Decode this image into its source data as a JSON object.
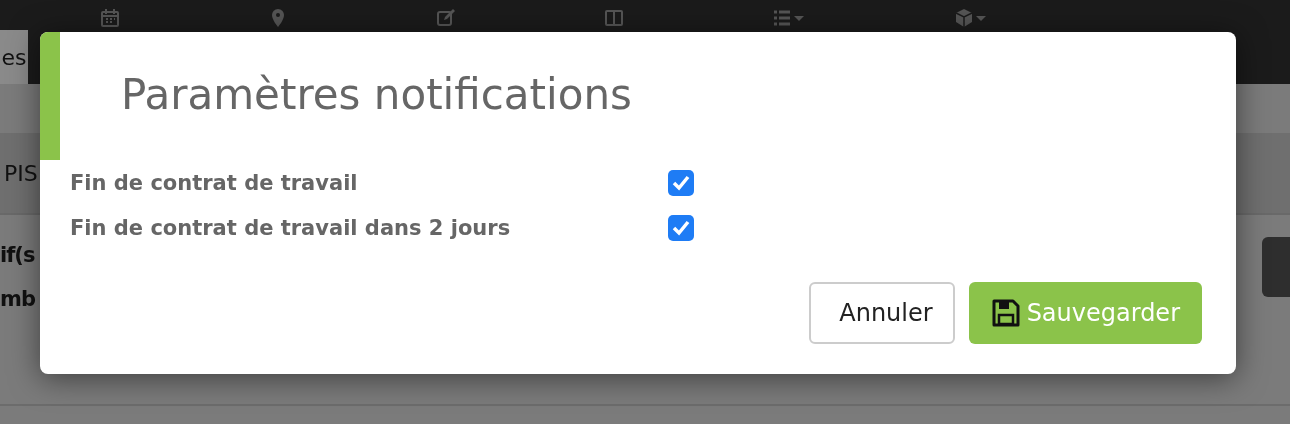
{
  "background": {
    "tab_label": "es",
    "band_label": "PIS",
    "lines": [
      "if(s",
      "mb"
    ]
  },
  "dialog": {
    "title": "Paramètres notifications",
    "options": [
      {
        "label": "Fin de contrat de travail",
        "checked": true
      },
      {
        "label": "Fin de contrat de travail dans 2 jours",
        "checked": true
      }
    ],
    "buttons": [
      {
        "kind": "cancel",
        "label": "Annuler"
      },
      {
        "kind": "save",
        "label": "Sauvegarder"
      }
    ]
  }
}
